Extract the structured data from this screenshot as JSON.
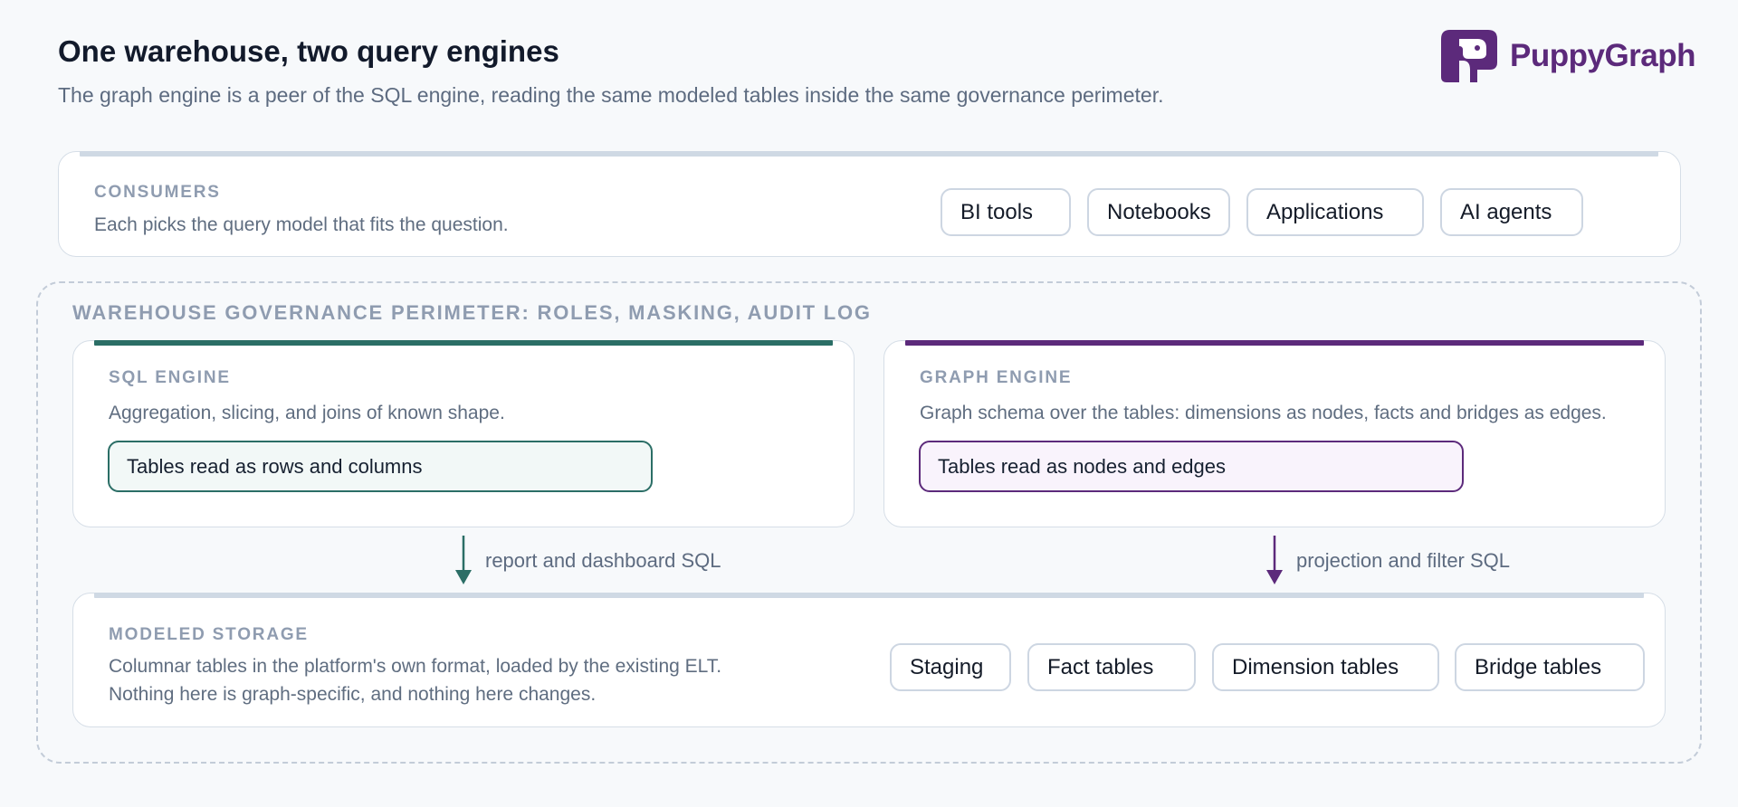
{
  "header": {
    "title": "One warehouse, two query engines",
    "subtitle": "The graph engine is a peer of the SQL engine, reading the same modeled tables inside the same governance perimeter.",
    "logo_text": "PuppyGraph",
    "logo_icon": "puppy-logo-icon"
  },
  "consumers": {
    "label": "CONSUMERS",
    "description": "Each picks the query model that fits the question.",
    "chips": [
      "BI tools",
      "Notebooks",
      "Applications",
      "AI agents"
    ]
  },
  "perimeter": {
    "label": "WAREHOUSE GOVERNANCE PERIMETER: ROLES, MASKING, AUDIT LOG"
  },
  "sql_engine": {
    "label": "SQL ENGINE",
    "description": "Aggregation, slicing, and joins of known shape.",
    "chip": "Tables read as rows and columns",
    "arrow_label": "report and dashboard SQL"
  },
  "graph_engine": {
    "label": "GRAPH ENGINE",
    "description": "Graph schema over the tables: dimensions as nodes, facts and bridges as edges.",
    "chip": "Tables read as nodes and edges",
    "arrow_label": "projection and filter SQL"
  },
  "storage": {
    "label": "MODELED STORAGE",
    "description_line1": "Columnar tables in the platform's own format, loaded by the existing ELT.",
    "description_line2": "Nothing here is graph-specific, and nothing here changes.",
    "chips": [
      "Staging",
      "Fact tables",
      "Dimension tables",
      "Bridge tables"
    ]
  },
  "colors": {
    "sql_accent": "#2b6e66",
    "graph_accent": "#5c2a7b",
    "neutral_bar": "#cfd9e4"
  }
}
